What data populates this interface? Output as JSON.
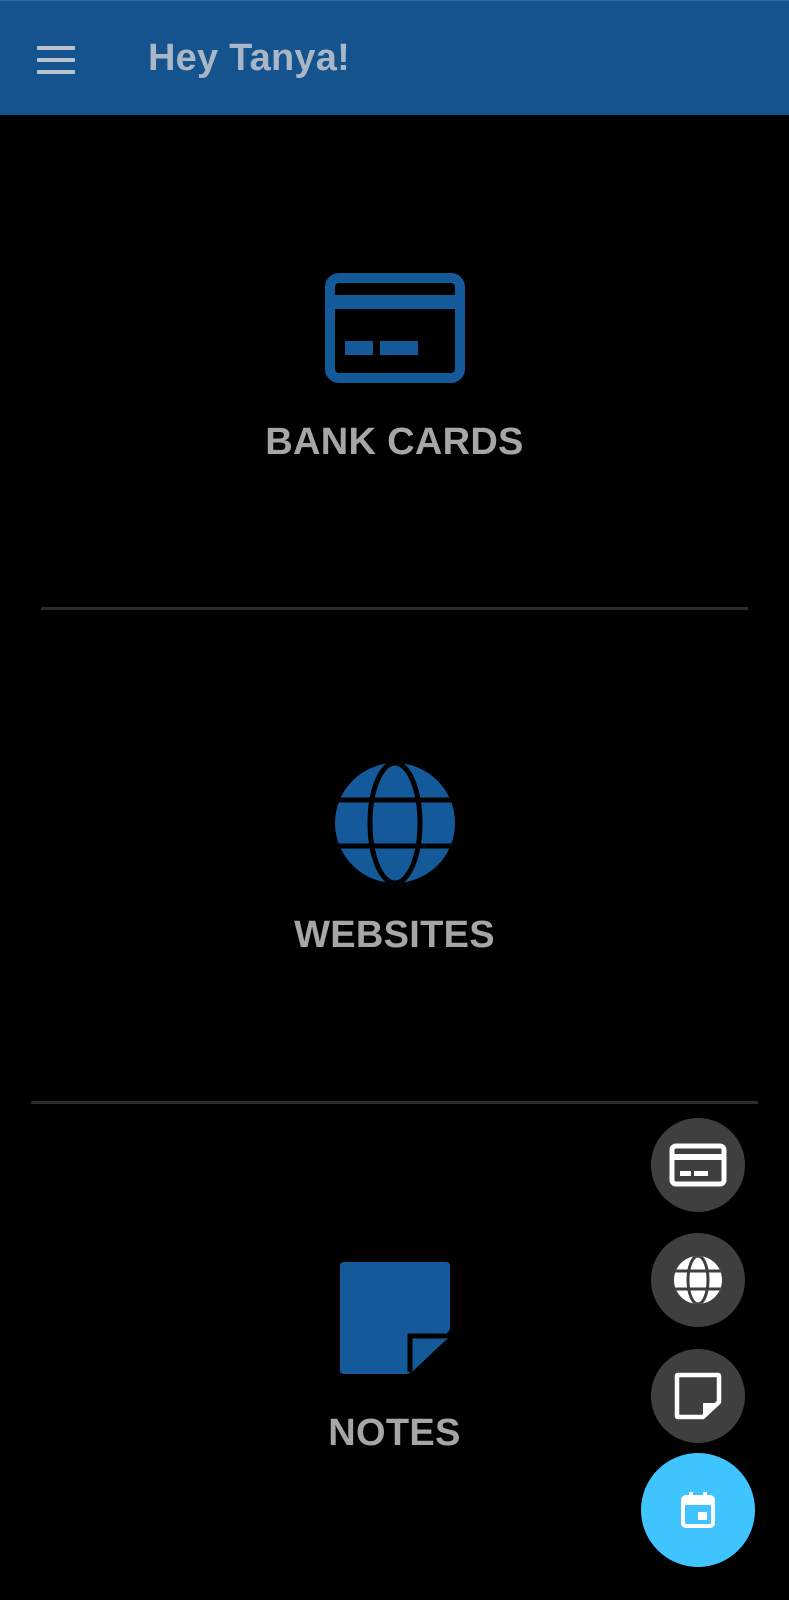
{
  "app_bar": {
    "menu_icon": "menu-icon",
    "title": "Hey Tanya!",
    "color": "#14538e"
  },
  "sections": {
    "bank_cards": {
      "label": "BANK CARDS",
      "icon": "credit-card-icon"
    },
    "websites": {
      "label": "WEBSITES",
      "icon": "globe-icon"
    },
    "notes": {
      "label": "NOTES",
      "icon": "note-icon"
    }
  },
  "fab_menu": {
    "items": [
      {
        "icon": "credit-card-icon"
      },
      {
        "icon": "globe-icon"
      },
      {
        "icon": "note-icon"
      }
    ],
    "main": {
      "icon": "calendar-icon",
      "color": "#40c4ff"
    }
  },
  "colors": {
    "accent": "#14538e",
    "label": "#a6a6a6",
    "background": "#000000"
  }
}
